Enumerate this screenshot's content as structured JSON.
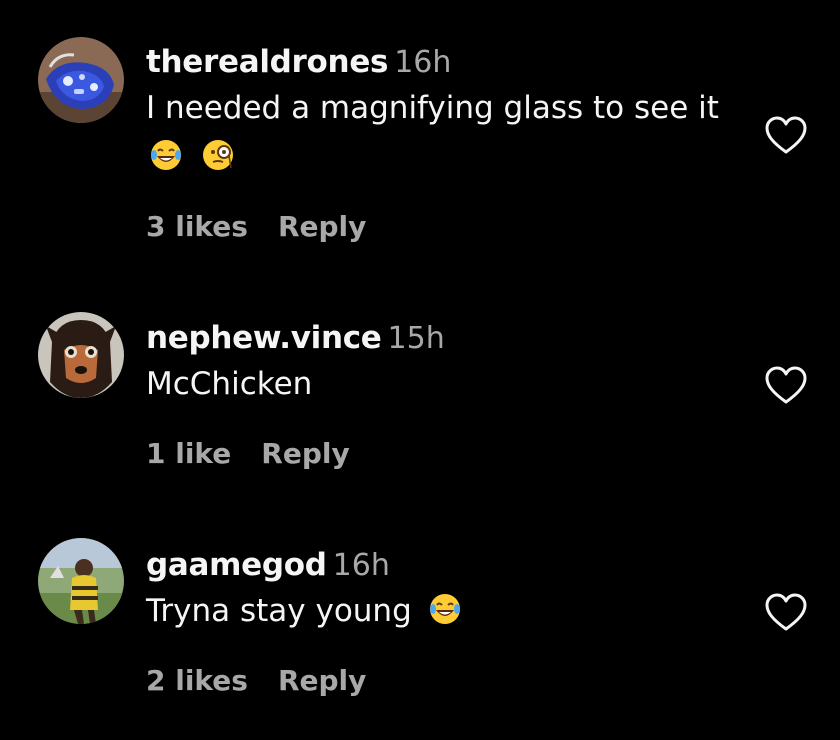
{
  "comments": [
    {
      "username": "therealdrones",
      "time": "16h",
      "text": "I needed a magnifying glass to see it",
      "emojis": [
        "face-with-tears-of-joy-emoji",
        "face-with-monocle-emoji"
      ],
      "likes": "3 likes",
      "reply": "Reply",
      "avatar": "blue-controller-avatar"
    },
    {
      "username": "nephew.vince",
      "time": "15h",
      "text": "McChicken",
      "emojis": [],
      "likes": "1 like",
      "reply": "Reply",
      "avatar": "dog-mask-avatar"
    },
    {
      "username": "gaamegod",
      "time": "16h",
      "text": "Tryna stay young",
      "emojis": [
        "face-with-tears-of-joy-emoji"
      ],
      "likes": "2 likes",
      "reply": "Reply",
      "avatar": "person-outdoors-avatar"
    }
  ],
  "colors": {
    "background": "#000000",
    "primary_text": "#f5f5f5",
    "secondary_text": "#a8a8a8",
    "emoji_yellow": "#ffcc33",
    "emoji_tear_blue": "#4aa8f0"
  },
  "icons": {
    "like": "heart-outline-icon"
  }
}
